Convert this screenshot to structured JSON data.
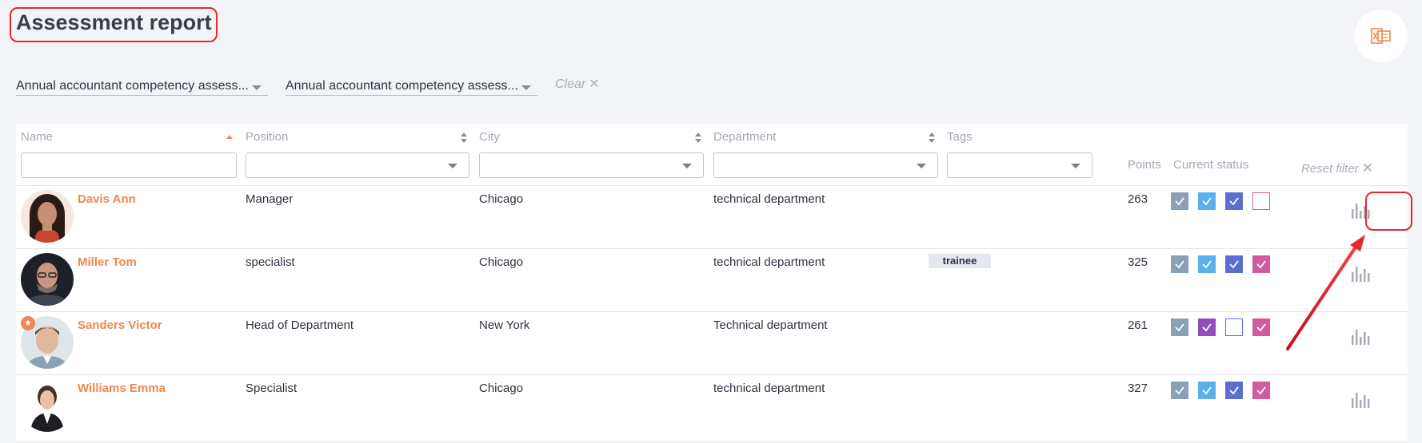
{
  "page": {
    "title": "Assessment report"
  },
  "toolbar": {
    "export_icon": "excel-export-icon"
  },
  "filters": {
    "select1": "Annual accountant competency assess...",
    "select2": "Annual accountant competency assess...",
    "clear_label": "Clear"
  },
  "table": {
    "headers": {
      "name": "Name",
      "position": "Position",
      "city": "City",
      "department": "Department",
      "tags": "Tags",
      "points": "Points",
      "status": "Current status"
    },
    "reset_filter_label": "Reset filter",
    "rows": [
      {
        "name": "Davis Ann",
        "position": "Manager",
        "city": "Chicago",
        "department": "technical department",
        "tag": "",
        "points": "263",
        "status": [
          "checked",
          "checked",
          "checked",
          "empty"
        ]
      },
      {
        "name": "Miller Tom",
        "position": "specialist",
        "city": "Chicago",
        "department": "technical department",
        "tag": "trainee",
        "points": "325",
        "status": [
          "checked",
          "checked",
          "checked",
          "checked"
        ]
      },
      {
        "name": "Sanders Victor",
        "position": "Head of Department",
        "city": "New York",
        "department": "Technical department",
        "tag": "",
        "points": "261",
        "status": [
          "checked",
          "checked",
          "empty",
          "checked"
        ]
      },
      {
        "name": "Williams Emma",
        "position": "Specialist",
        "city": "Chicago",
        "department": "technical department",
        "tag": "",
        "points": "327",
        "status": [
          "checked",
          "checked",
          "checked",
          "checked"
        ]
      }
    ]
  },
  "colors": {
    "accent": "#f0874f",
    "highlight": "#e8262d",
    "status": [
      "#8aa0b6",
      "#5ab0ea",
      "#5a6fd0",
      "#d25a9e"
    ],
    "status_row3_col2": "#8e4fb8"
  }
}
